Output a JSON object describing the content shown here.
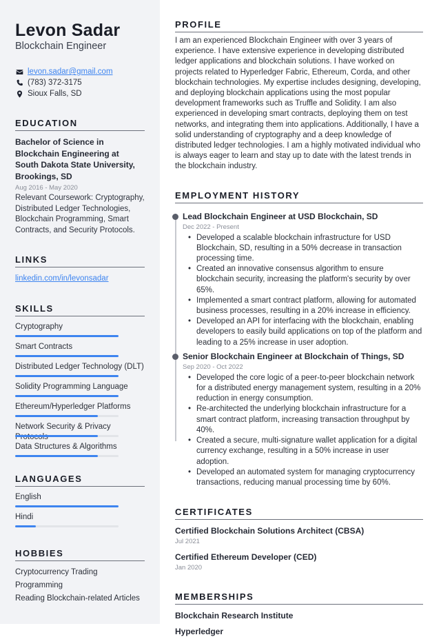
{
  "header": {
    "name": "Levon Sadar",
    "title": "Blockchain Engineer"
  },
  "contact": {
    "email": "levon.sadar@gmail.com",
    "phone": "(783) 372-3175",
    "location": "Sioux Falls, SD",
    "icons": [
      "envelope-icon",
      "phone-icon",
      "map-pin-icon"
    ]
  },
  "education": {
    "heading": "EDUCATION",
    "degree": "Bachelor of Science in Blockchain Engineering at South Dakota State University, Brookings, SD",
    "dates": "Aug 2016 - May 2020",
    "description": "Relevant Coursework: Cryptography, Distributed Ledger Technologies, Blockchain Programming, Smart Contracts, and Security Protocols."
  },
  "links": {
    "heading": "LINKS",
    "items": [
      "linkedin.com/in/levonsadar"
    ]
  },
  "skills": {
    "heading": "SKILLS",
    "items": [
      {
        "label": "Cryptography",
        "level": 100
      },
      {
        "label": "Smart Contracts",
        "level": 100
      },
      {
        "label": "Distributed Ledger Technology (DLT)",
        "level": 100
      },
      {
        "label": "Solidity Programming Language",
        "level": 100
      },
      {
        "label": "Ethereum/Hyperledger Platforms",
        "level": 80
      },
      {
        "label": "Network Security & Privacy Protocols",
        "level": 80
      },
      {
        "label": "Data Structures & Algorithms",
        "level": 80
      }
    ]
  },
  "languages": {
    "heading": "LANGUAGES",
    "items": [
      {
        "label": "English",
        "level": 100
      },
      {
        "label": "Hindi",
        "level": 20
      }
    ]
  },
  "hobbies": {
    "heading": "HOBBIES",
    "items": [
      "Cryptocurrency Trading",
      "Programming",
      "Reading Blockchain-related Articles"
    ]
  },
  "profile": {
    "heading": "PROFILE",
    "text": "I am an experienced Blockchain Engineer with over 3 years of experience. I have extensive experience in developing distributed ledger applications and blockchain solutions. I have worked on projects related to Hyperledger Fabric, Ethereum, Corda, and other blockchain technologies. My expertise includes designing, developing, and deploying blockchain applications using the most popular development frameworks such as Truffle and Solidity. I am also experienced in developing smart contracts, deploying them on test networks, and integrating them into applications. Additionally, I have a solid understanding of cryptography and a deep knowledge of distributed ledger technologies. I am a highly motivated individual who is always eager to learn and stay up to date with the latest trends in the blockchain industry."
  },
  "employment": {
    "heading": "EMPLOYMENT HISTORY",
    "jobs": [
      {
        "title": "Lead Blockchain Engineer at USD Blockchain, SD",
        "dates": "Dec 2022 - Present",
        "bullets": [
          "Developed a scalable blockchain infrastructure for USD Blockchain, SD, resulting in a 50% decrease in transaction processing time.",
          "Created an innovative consensus algorithm to ensure blockchain security, increasing the platform's security by over 65%.",
          "Implemented a smart contract platform, allowing for automated business processes, resulting in a 20% increase in efficiency.",
          "Developed an API for interfacing with the blockchain, enabling developers to easily build applications on top of the platform and leading to a 25% increase in user adoption."
        ]
      },
      {
        "title": "Senior Blockchain Engineer at Blockchain of Things, SD",
        "dates": "Sep 2020 - Oct 2022",
        "bullets": [
          "Developed the core logic of a peer-to-peer blockchain network for a distributed energy management system, resulting in a 20% reduction in energy consumption.",
          "Re-architected the underlying blockchain infrastructure for a smart contract platform, increasing transaction throughput by 40%.",
          "Created a secure, multi-signature wallet application for a digital currency exchange, resulting in a 50% increase in user adoption.",
          "Developed an automated system for managing cryptocurrency transactions, reducing manual processing time by 60%."
        ]
      }
    ]
  },
  "certificates": {
    "heading": "CERTIFICATES",
    "items": [
      {
        "title": "Certified Blockchain Solutions Architect (CBSA)",
        "date": "Jul 2021"
      },
      {
        "title": "Certified Ethereum Developer (CED)",
        "date": "Jan 2020"
      }
    ]
  },
  "memberships": {
    "heading": "MEMBERSHIPS",
    "items": [
      "Blockchain Research Institute",
      "Hyperledger"
    ]
  },
  "colors": {
    "accent": "#3d84f0",
    "sidebar_bg": "#f2f3f6",
    "text": "#2b2f38",
    "muted": "#8a8e98"
  }
}
